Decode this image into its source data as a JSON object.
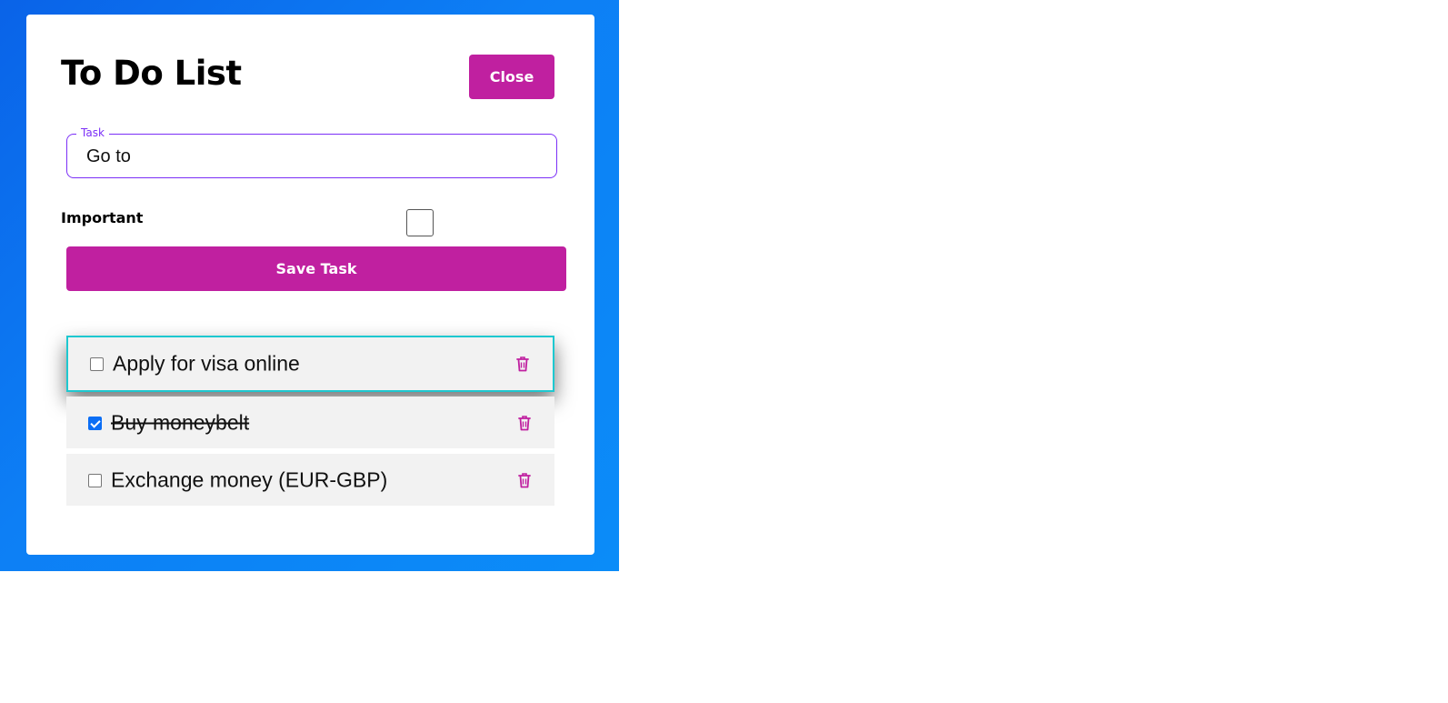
{
  "app": {
    "title": "To Do List",
    "close_label": "Close"
  },
  "form": {
    "task_legend": "Task",
    "task_value": "Go to",
    "important_label": "Important",
    "important_checked": false,
    "save_label": "Save Task"
  },
  "tasks": [
    {
      "label": "Apply for visa online",
      "completed": false,
      "focused": true
    },
    {
      "label": "Buy moneybelt",
      "completed": true,
      "focused": false
    },
    {
      "label": "Exchange money (EUR-GBP)",
      "completed": false,
      "focused": false
    }
  ],
  "icons": {
    "delete": "trash-icon"
  },
  "colors": {
    "accent": "#c020a0",
    "field_border": "#7b2ff7",
    "focus_outline": "#1ec8d0",
    "checkbox_checked": "#0b6ef5",
    "background": "#0d7ff5"
  }
}
